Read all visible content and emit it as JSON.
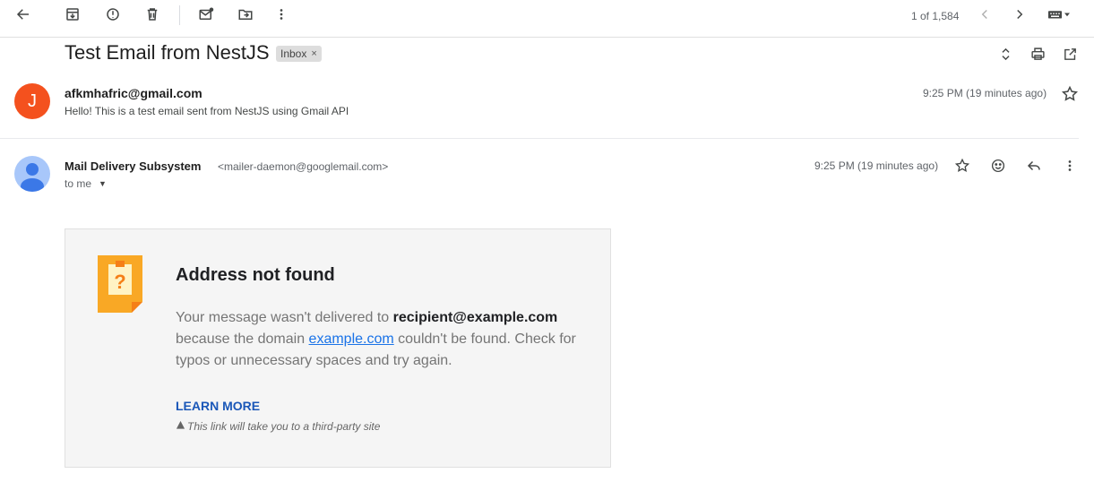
{
  "toolbar": {
    "pager": "1 of 1,584"
  },
  "thread": {
    "subject": "Test Email from NestJS",
    "label": "Inbox",
    "label_remove": "×"
  },
  "message1": {
    "avatar_letter": "J",
    "avatar_color": "#f4511e",
    "sender": "afkmhafric@gmail.com",
    "snippet": "Hello! This is a test email sent from NestJS using Gmail API",
    "time": "9:25 PM (19 minutes ago)"
  },
  "message2": {
    "sender_name": "Mail Delivery Subsystem",
    "sender_email": "<mailer-daemon@googlemail.com>",
    "to_me": "to me",
    "time": "9:25 PM (19 minutes ago)"
  },
  "bounce": {
    "title": "Address not found",
    "body_prefix": "Your message wasn't delivered to ",
    "recipient": "recipient@example.com",
    "body_mid": " because the domain ",
    "domain": "example.com",
    "body_suffix": " couldn't be found. Check for typos or unnecessary spaces and try again.",
    "learn_more": "LEARN MORE",
    "third_party": "This link will take you to a third-party site",
    "accent_color": "#f9a825",
    "link_color": "#1a73e8"
  }
}
